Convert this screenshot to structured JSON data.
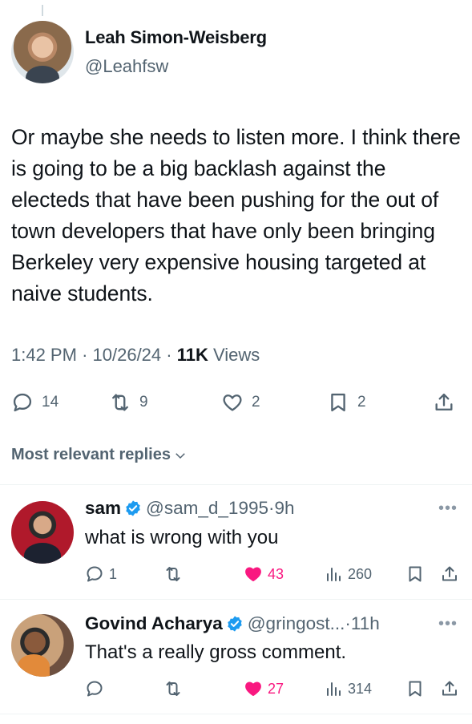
{
  "tweet": {
    "author": {
      "name": "Leah Simon-Weisberg",
      "handle": "@Leahfsw"
    },
    "text": "Or maybe she needs to listen more. I think there is going to be a big backlash against the electeds that have been pushing for the out of town developers that have only been bringing Berkeley very expensive housing targeted at naive students.",
    "time": "1:42 PM",
    "date": "10/26/24",
    "views_count": "11K",
    "views_label": "Views",
    "separator": "·",
    "actions": {
      "replies": "14",
      "reposts": "9",
      "likes": "2",
      "bookmarks": "2"
    }
  },
  "replies_header": "Most relevant replies",
  "replies": [
    {
      "name": "sam",
      "handle": "@sam_d_1995",
      "time": "9h",
      "text": "what is wrong with you",
      "replies": "1",
      "reposts": "",
      "likes": "43",
      "views": "260",
      "liked": true,
      "verified": true
    },
    {
      "name": "Govind Acharya",
      "handle": "@gringost...",
      "time": "11h",
      "text": "That's a really gross comment.",
      "replies": "",
      "reposts": "",
      "likes": "27",
      "views": "314",
      "liked": true,
      "verified": true
    }
  ],
  "colors": {
    "accent": "#1d9bf0",
    "like": "#f91880",
    "secondary_text": "#536471",
    "text": "#0f1419"
  },
  "icons": [
    "reply-icon",
    "repost-icon",
    "like-icon",
    "bookmark-icon",
    "share-icon",
    "views-icon",
    "verified-icon",
    "chevron-down-icon",
    "more-icon"
  ]
}
